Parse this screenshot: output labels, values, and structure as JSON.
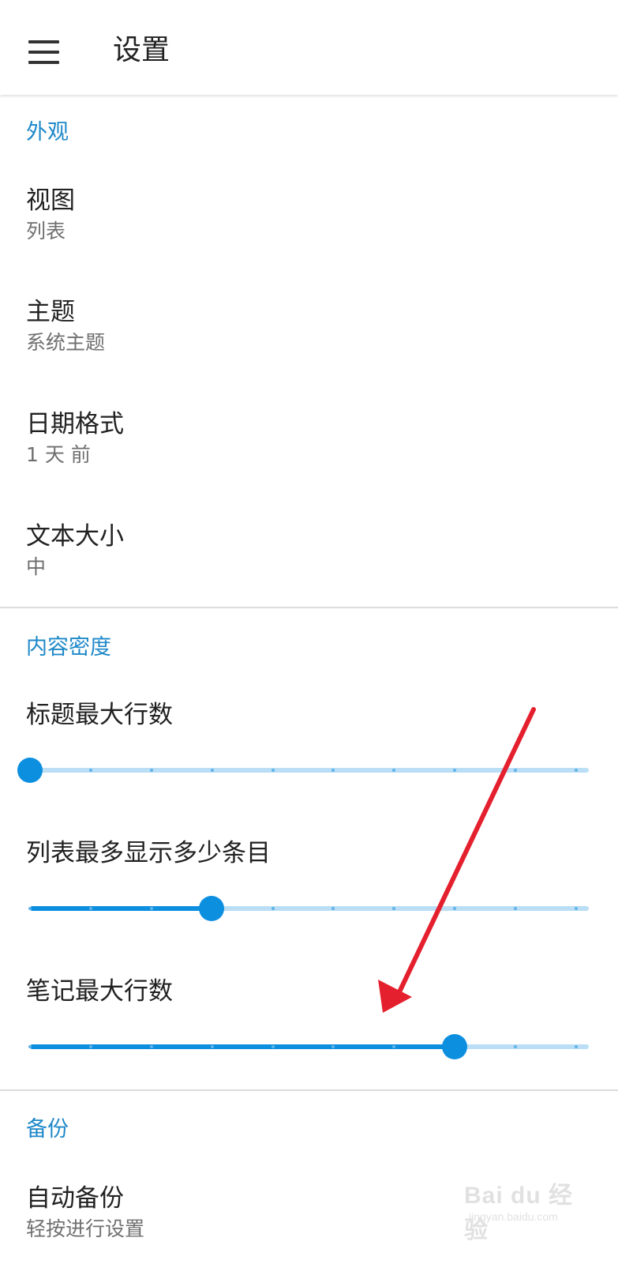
{
  "app_bar": {
    "title": "设置",
    "menu_icon": "menu-icon"
  },
  "sections": {
    "appearance": {
      "header": "外观",
      "items": [
        {
          "title": "视图",
          "summary": "列表"
        },
        {
          "title": "主题",
          "summary": "系统主题"
        },
        {
          "title": "日期格式",
          "summary": "1 天 前"
        },
        {
          "title": "文本大小",
          "summary": "中"
        }
      ]
    },
    "density": {
      "header": "内容密度",
      "sliders": [
        {
          "title": "标题最大行数",
          "value_fraction": 0.0
        },
        {
          "title": "列表最多显示多少条目",
          "value_fraction": 0.333
        },
        {
          "title": "笔记最大行数",
          "value_fraction": 0.778
        }
      ],
      "slider_ticks": 10
    },
    "backup": {
      "header": "备份",
      "items": [
        {
          "title": "自动备份",
          "summary": "轻按进行设置"
        }
      ]
    }
  },
  "colors": {
    "accent": "#1e88c9",
    "slider_active": "#0d8fe0",
    "slider_inactive": "#b9def5",
    "annotation_arrow": "#e5202e"
  },
  "watermark": {
    "main": "Bai du 经验",
    "sub": "jingyan.baidu.com"
  }
}
